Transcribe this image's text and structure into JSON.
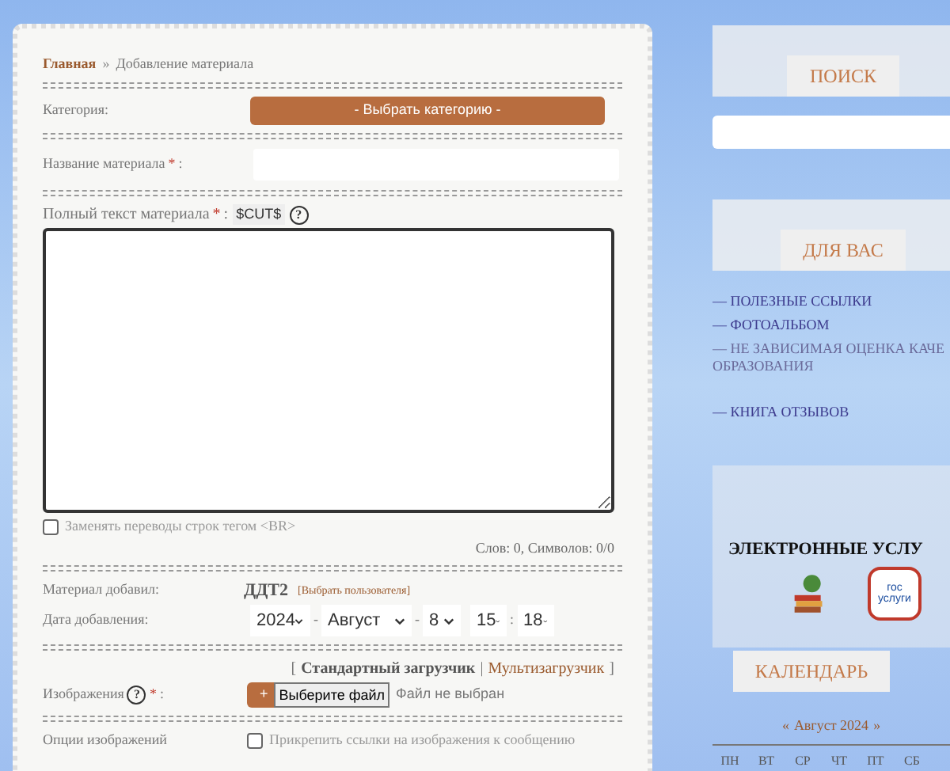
{
  "breadcrumb": {
    "home": "Главная",
    "separator": "»",
    "current": "Добавление материала"
  },
  "form": {
    "category": {
      "label": "Категория:",
      "button": "- Выбрать категорию -"
    },
    "title_field": {
      "label": "Название материала",
      "required": "*",
      "colon": ":"
    },
    "full_text": {
      "label": "Полный текст материала",
      "required": "*",
      "colon": ":",
      "cut_tag": "$CUT$",
      "help": "?"
    },
    "replace_br": {
      "label": "Заменять переводы строк тегом <BR>",
      "checked": false
    },
    "counter": "Слов: 0, Символов: 0/0",
    "author": {
      "label": "Материал добавил:",
      "value": "ДДТ2",
      "link": "[Выбрать пользователя]"
    },
    "date": {
      "label": "Дата добавления:",
      "year": "2024",
      "month": "Август",
      "day": "8",
      "hour": "15",
      "minute": "18",
      "separators": [
        "-",
        "-",
        ":"
      ]
    },
    "loader_brackets": {
      "open": "[",
      "divider": "|",
      "close": "]"
    },
    "loaders": [
      {
        "label": "Стандартный загрузчик",
        "selected": true
      },
      {
        "label": "Мультизагрузчик",
        "selected": false
      }
    ],
    "images": {
      "label": "Изображения",
      "help": "?",
      "required": "*",
      "colon": ":",
      "plus": "+",
      "file_button": "Выберите файл",
      "file_status": "Файл не выбран"
    },
    "image_options": {
      "label": "Опции изображений",
      "checkbox": "Прикрепить ссылки на изображения к сообщению",
      "checked": false
    }
  },
  "sidebar": {
    "search_title": "ПОИСК",
    "for_you_title": "ДЛЯ ВАС",
    "links": [
      {
        "label": "— ПОЛЕЗНЫЕ ССЫЛКИ"
      },
      {
        "label": "— ФОТОАЛЬБОМ"
      },
      {
        "label": "— НЕ ЗАВИСИМАЯ ОЦЕНКА КАЧЕ",
        "continuation": "ОБРАЗОВАНИЯ"
      },
      {
        "label": "— КНИГА ОТЗЫВОВ"
      }
    ],
    "services_title": "ЭЛЕКТРОННЫЕ УСЛУ",
    "gosuslugi": [
      "гос",
      "услуги"
    ],
    "calendar_title": "КАЛЕНДАРЬ",
    "calendar": {
      "prev": "«",
      "month": "Август 2024",
      "next": "»",
      "weekdays": [
        "ПН",
        "ВТ",
        "СР",
        "ЧТ",
        "ПТ",
        "СБ"
      ]
    }
  }
}
